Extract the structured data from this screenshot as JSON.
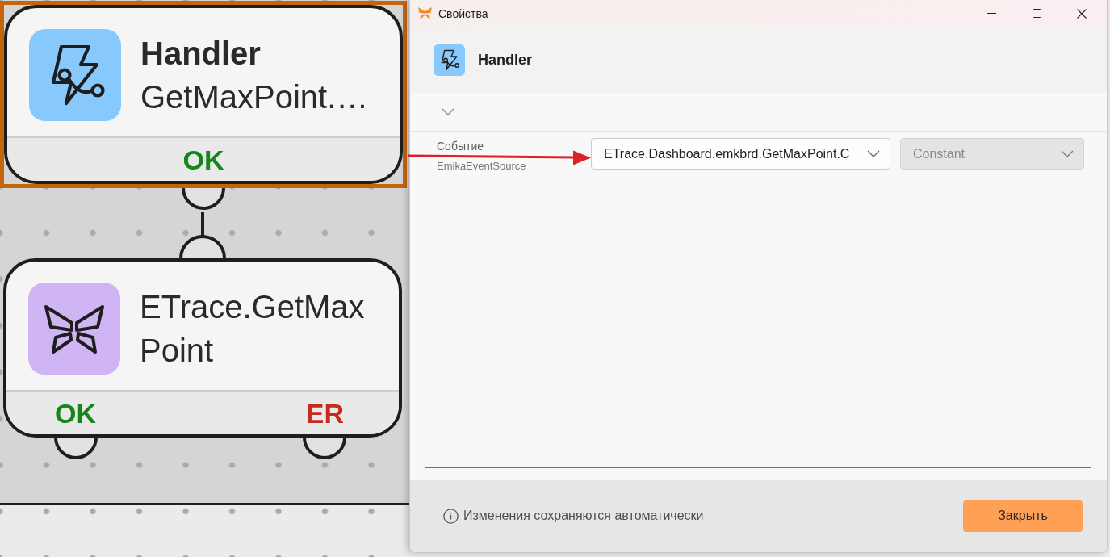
{
  "canvas": {
    "nodes": [
      {
        "kind": "handler",
        "title": "Handler",
        "subtitle": "GetMaxPoint.…",
        "selected": true,
        "input_port": false,
        "outputs": [
          {
            "label": "OK",
            "kind": "ok"
          }
        ]
      },
      {
        "kind": "service",
        "title": "ETrace.GetMaxPoint",
        "selected": false,
        "input_port": true,
        "outputs": [
          {
            "label": "OK",
            "kind": "ok"
          },
          {
            "label": "ER",
            "kind": "error"
          }
        ]
      }
    ]
  },
  "dialog": {
    "title": "Свойства",
    "header": {
      "kind": "handler",
      "title": "Handler"
    },
    "section": {
      "expanded": false
    },
    "properties": [
      {
        "label": "Событие",
        "type": "EmikaEventSource",
        "value": "ETrace.Dashboard.emkbrd.GetMaxPoint.C",
        "mode": {
          "value": "Constant",
          "disabled": true
        }
      }
    ],
    "footer": {
      "info": "Изменения сохраняются автоматически",
      "close_button": "Закрыть"
    }
  },
  "annotations": [
    {
      "kind": "arrow"
    }
  ]
}
